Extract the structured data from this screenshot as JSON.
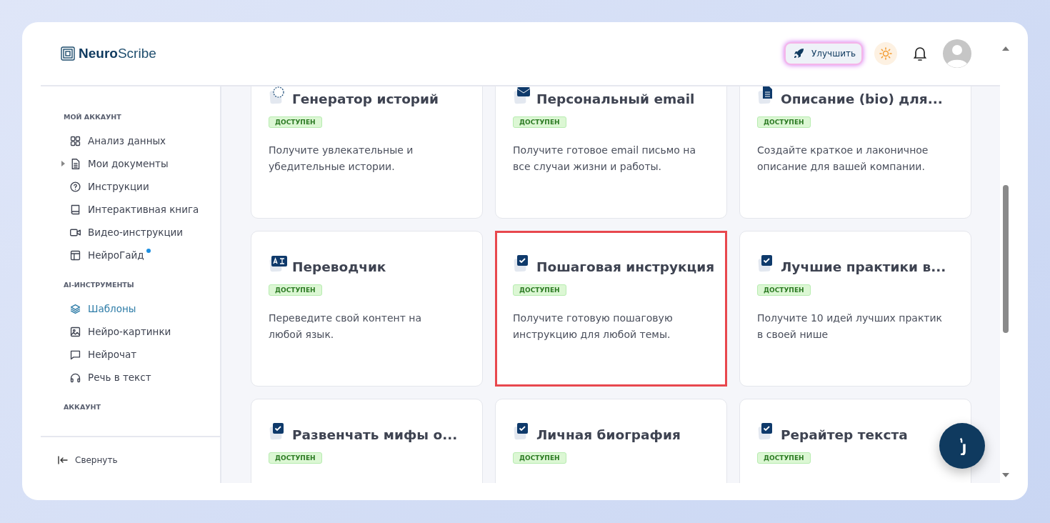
{
  "header": {
    "logo": "**Neuro**Scribe",
    "upgrade_button": "Улучшить"
  },
  "sidebar": {
    "sections": [
      {
        "heading": "МОЙ АККАУНТ",
        "items": [
          {
            "label": "Анализ данных",
            "selected": false
          },
          {
            "label": "Мои документы",
            "selected": false,
            "expandable": true
          },
          {
            "label": "Инструкции",
            "selected": false
          },
          {
            "label": "Интерактивная книга",
            "selected": false
          },
          {
            "label": "Видео-инструкции",
            "selected": false
          },
          {
            "label": "НейроГайд",
            "selected": false,
            "new_dot": true
          }
        ]
      },
      {
        "heading": "AI-ИНСТРУМЕНТЫ",
        "items": [
          {
            "label": "Шаблоны",
            "selected": true
          },
          {
            "label": "Нейро-картинки",
            "selected": false
          },
          {
            "label": "Нейрочат",
            "selected": false
          },
          {
            "label": "Речь в текст",
            "selected": false
          }
        ]
      },
      {
        "heading": "АККАУНТ"
      }
    ],
    "collapse": "Свернуть"
  },
  "cards": [
    {
      "title": "Генератор историй",
      "badge": "ДОСТУПЕН",
      "description": "Получите увлекательные и убедительные истории.",
      "highlighted": false
    },
    {
      "title": "Персональный email",
      "badge": "ДОСТУПЕН",
      "description": "Получите готовое email письмо на все случаи жизни и работы.",
      "highlighted": false
    },
    {
      "title": "Описание (bio) для...",
      "badge": "ДОСТУПЕН",
      "description": "Создайте краткое и лаконичное описание для вашей компании.",
      "highlighted": false
    },
    {
      "title": "Переводчик",
      "badge": "ДОСТУПЕН",
      "description": "Переведите свой контент на любой язык.",
      "highlighted": false
    },
    {
      "title": "Пошаговая инструкция",
      "badge": "ДОСТУПЕН",
      "description": "Получите готовую пошаговую инструкцию для любой темы.",
      "highlighted": true
    },
    {
      "title": "Лучшие практики в...",
      "badge": "ДОСТУПЕН",
      "description": "Получите 10 идей лучших практик в своей нише",
      "highlighted": false
    },
    {
      "title": "Развенчать мифы о...",
      "badge": "ДОСТУПЕН",
      "highlighted": false
    },
    {
      "title": "Личная биография",
      "badge": "ДОСТУПЕН",
      "highlighted": false
    },
    {
      "title": "Рерайтер текста",
      "badge": "ДОСТУПЕН",
      "highlighted": false
    }
  ]
}
